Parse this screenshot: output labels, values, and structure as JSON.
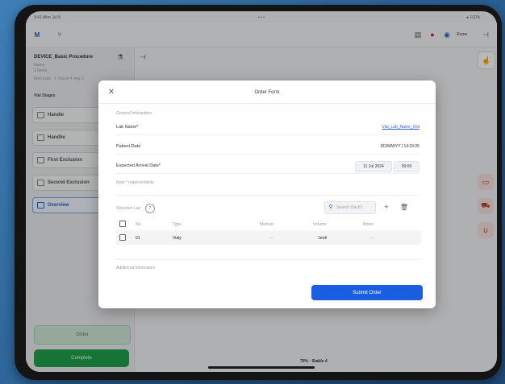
{
  "status_bar": {
    "time": "9:41 Mon Jul 8",
    "dots": "• • •",
    "battery": "● 100%"
  },
  "app_bar": {
    "logo": "M",
    "branch_icon": "branch-icon",
    "right_label": "Rome"
  },
  "procedure": {
    "title": "DEVICE_Basic Procedure",
    "line1": "Name",
    "line2": "1 Items",
    "line3": "Item note · 1 Vial at 4 deg C"
  },
  "stages": {
    "header": "Vial Stages",
    "items": [
      "Handle",
      "Handlie",
      "First Exclusion",
      "Second Exclusion",
      "Overview"
    ]
  },
  "left_buttons": {
    "order": "Order",
    "complete": "Complete"
  },
  "bottom_center": "70% · Stable 4",
  "modal": {
    "title": "Order Form",
    "section_general": "General Information",
    "lab_name_label": "Lab Name*",
    "lab_name_value": "Vial_Lab_Name_Ord",
    "patient_date_label": "Patient Date",
    "patient_date_value": "DD/MM/YY | 14:03:05",
    "expected_label": "Expected Arrival Date*",
    "expected_date": "11 Jul 2024",
    "expected_time": "09:00",
    "required_note": "Note * required fields",
    "selection_label": "Selection List",
    "search_placeholder": "Search Vial ID",
    "plus": "+",
    "table_headers": [
      "No.",
      "Type",
      "Method",
      "Volume",
      "Notes"
    ],
    "table_rows": [
      [
        "01",
        "Vialy",
        "—",
        "1mdl",
        "—"
      ]
    ],
    "section_additional": "Additional Information",
    "submit": "Submit Order"
  }
}
